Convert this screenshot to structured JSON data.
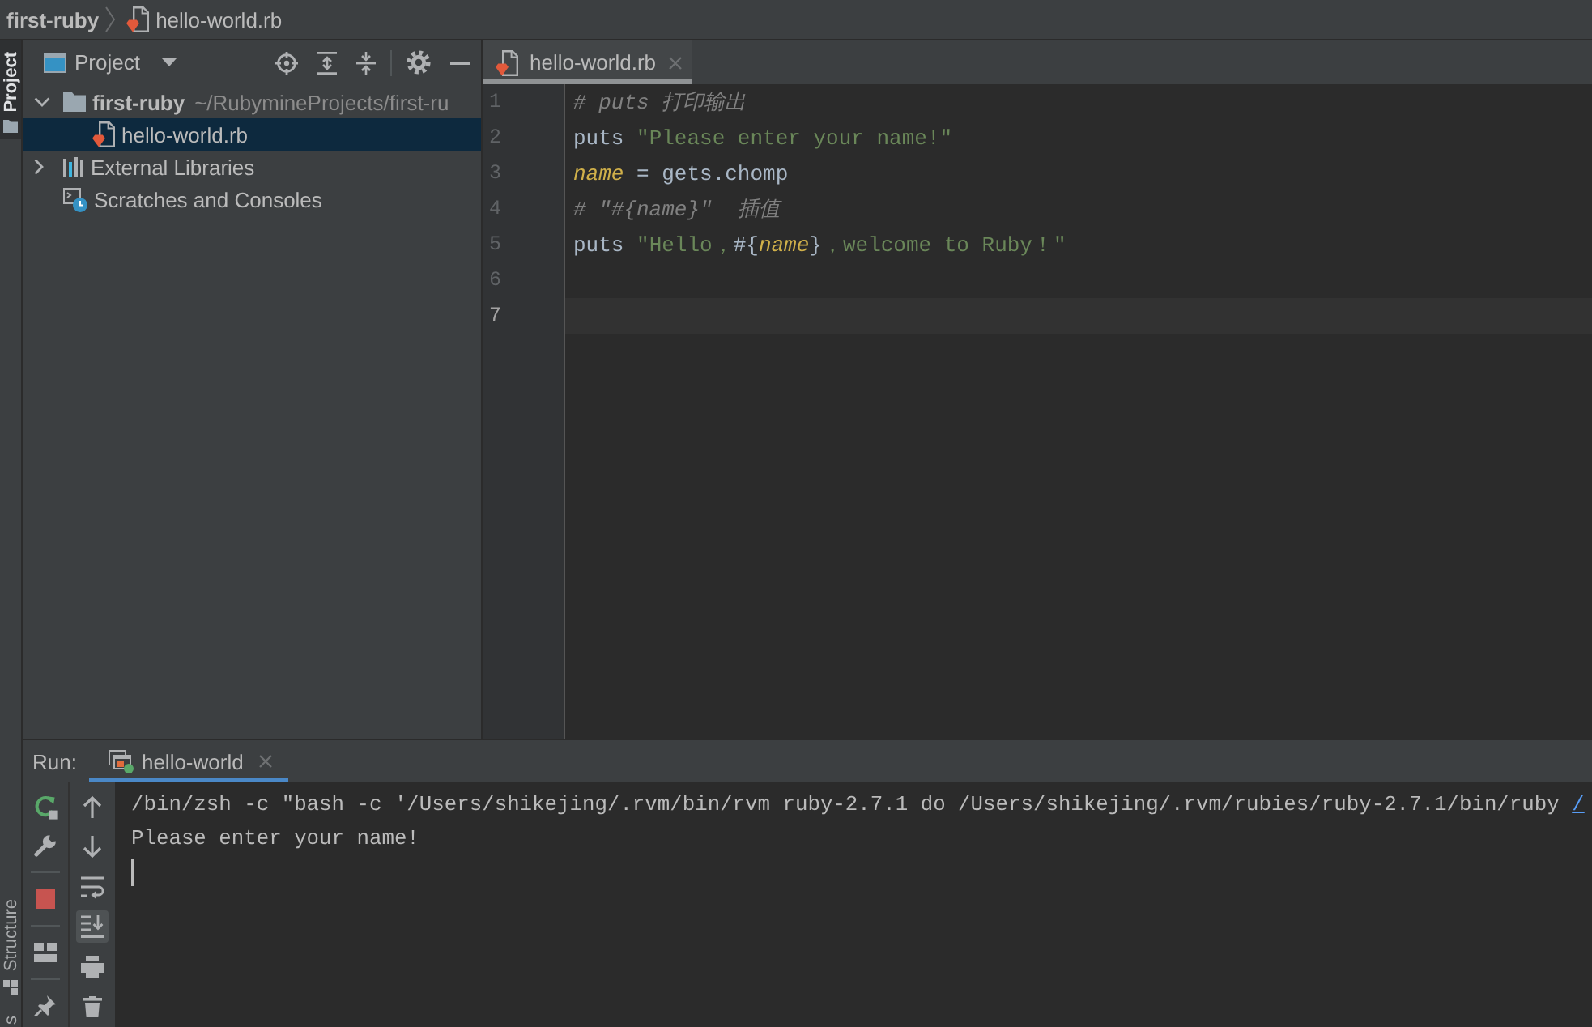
{
  "navigation_bar": {
    "breadcrumbs": [
      {
        "kind": "project",
        "text": "first-ruby"
      },
      {
        "kind": "file",
        "text": "hello-world.rb"
      }
    ]
  },
  "tool_stripe": {
    "top_tabs": [
      {
        "kind": "project",
        "label": "Project",
        "selected": true
      }
    ],
    "bottom_tabs": [
      {
        "kind": "structure",
        "label": "Structure",
        "selected": false
      },
      {
        "kind": "other",
        "label": "s",
        "selected": false
      }
    ]
  },
  "project_panel": {
    "title": "Project",
    "tree": [
      {
        "kind": "folder",
        "name": "first-ruby",
        "path": "~/RubymineProjects/first-ru",
        "expanded": true,
        "selected": false,
        "children": [
          {
            "kind": "ruby-file",
            "name": "hello-world.rb",
            "selected": true
          }
        ]
      },
      {
        "kind": "libraries",
        "name": "External Libraries",
        "expanded": false,
        "selected": false
      },
      {
        "kind": "scratches",
        "name": "Scratches and Consoles",
        "selected": false
      }
    ]
  },
  "editor": {
    "tabs": [
      {
        "label": "hello-world.rb",
        "selected": true
      }
    ],
    "lines": [
      {
        "number": "1",
        "current": false,
        "tokens": [
          {
            "kind": "comment",
            "text": "# puts 打印输出"
          }
        ]
      },
      {
        "number": "2",
        "current": false,
        "tokens": [
          {
            "kind": "code",
            "text": "puts "
          },
          {
            "kind": "string",
            "text": "\"Please enter your name!\""
          }
        ]
      },
      {
        "number": "3",
        "current": false,
        "tokens": [
          {
            "kind": "variable",
            "text": "name"
          },
          {
            "kind": "code",
            "text": " = gets.chomp"
          }
        ]
      },
      {
        "number": "4",
        "current": false,
        "tokens": [
          {
            "kind": "comment",
            "text": "# \"#{name}\"  插值"
          }
        ]
      },
      {
        "number": "5",
        "current": false,
        "tokens": [
          {
            "kind": "code",
            "text": "puts "
          },
          {
            "kind": "string",
            "text": "\"Hello，"
          },
          {
            "kind": "code",
            "text": "#{"
          },
          {
            "kind": "variable",
            "text": "name"
          },
          {
            "kind": "code",
            "text": "}"
          },
          {
            "kind": "string",
            "text": "，welcome to Ruby！\""
          }
        ]
      },
      {
        "number": "6",
        "current": false
      },
      {
        "number": "7",
        "current": true
      }
    ]
  },
  "run_panel": {
    "title": "Run:",
    "tabs": [
      {
        "label": "hello-world",
        "selected": true
      }
    ],
    "console_toolbar": [
      {
        "kind": "up",
        "on": false
      },
      {
        "kind": "down",
        "on": false
      },
      {
        "kind": "soft-wrap",
        "on": false
      },
      {
        "kind": "scroll-to-end",
        "on": true
      },
      {
        "kind": "print",
        "on": false
      },
      {
        "kind": "clear",
        "on": false
      }
    ],
    "console": {
      "lines": [
        {
          "text": "/bin/zsh -c \"bash -c '/Users/shikejing/.rvm/bin/rvm ruby-2.7.1 do /Users/shikejing/.rvm/rubies/ruby-2.7.1/bin/ruby",
          "link": "/"
        },
        {
          "text": "Please enter your name!"
        }
      ]
    }
  }
}
